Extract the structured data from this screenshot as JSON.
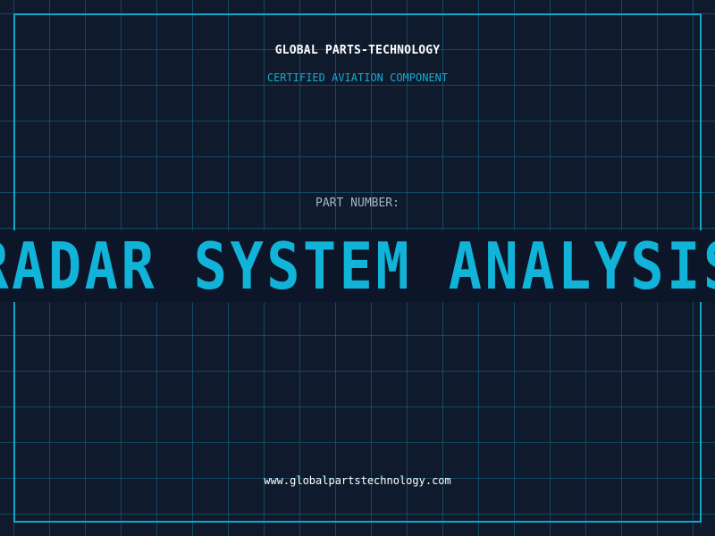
{
  "header": {
    "company_name": "GLOBAL PARTS-TECHNOLOGY",
    "tagline": "CERTIFIED AVIATION COMPONENT"
  },
  "part": {
    "label": "PART NUMBER:",
    "value": "RADAR SYSTEM ANALYSIS"
  },
  "footer": {
    "url": "www.globalpartstechnology.com"
  },
  "colors": {
    "background": "#0f1a2d",
    "grid": "#166e8c",
    "accent": "#12b3d9",
    "label": "#a8b4c2",
    "text": "#ffffff"
  }
}
